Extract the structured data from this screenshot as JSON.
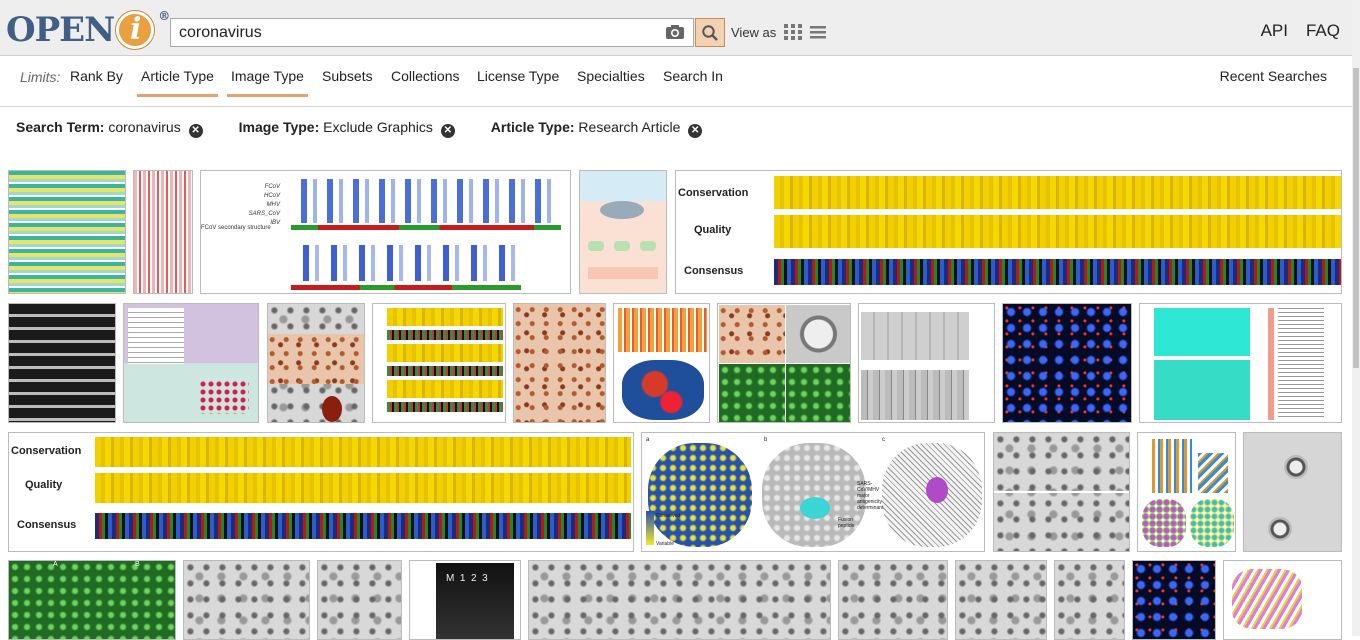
{
  "brand": {
    "logo_text_a": "OPEN",
    "logo_text_i": "i",
    "registered": "®"
  },
  "search": {
    "value": "coronavirus",
    "placeholder": ""
  },
  "view_as": {
    "label": "View as"
  },
  "top_links": {
    "api": "API",
    "faq": "FAQ"
  },
  "limits": {
    "label": "Limits:",
    "tabs": [
      {
        "label": "Rank By",
        "active": false
      },
      {
        "label": "Article Type",
        "active": true
      },
      {
        "label": "Image Type",
        "active": true
      },
      {
        "label": "Subsets",
        "active": false
      },
      {
        "label": "Collections",
        "active": false
      },
      {
        "label": "License Type",
        "active": false
      },
      {
        "label": "Specialties",
        "active": false
      },
      {
        "label": "Search In",
        "active": false
      }
    ],
    "recent": "Recent Searches"
  },
  "filters": [
    {
      "name": "Search Term:",
      "value": "coronavirus"
    },
    {
      "name": "Image Type:",
      "value": "Exclude Graphics"
    },
    {
      "name": "Article Type:",
      "value": "Research Article"
    }
  ],
  "thumbnails": {
    "alignment_labels": {
      "conservation": "Conservation",
      "quality": "Quality",
      "consensus": "Consensus"
    },
    "panel_labels": {
      "a": "a",
      "b": "b",
      "c": "c",
      "A": "A",
      "B": "B"
    },
    "gel_lanes": "M  1  2  3",
    "seq_labels": [
      "FCoV",
      "HCoV",
      "MHV",
      "SARS_CoV",
      "IBV"
    ],
    "secondary_structure": "FCoV secondary structure",
    "structure_labels": {
      "fusion_peptide": "Fusion peptide",
      "conserved": "Conserved",
      "variable": "Variable",
      "sars_major": "SARS-CoV/MHV major antigenicity determinant"
    }
  },
  "colors": {
    "accent": "#e2a46c",
    "brand_blue": "#3f5f86",
    "brand_orange": "#e8a040",
    "search_button": "#f3d2b3"
  }
}
